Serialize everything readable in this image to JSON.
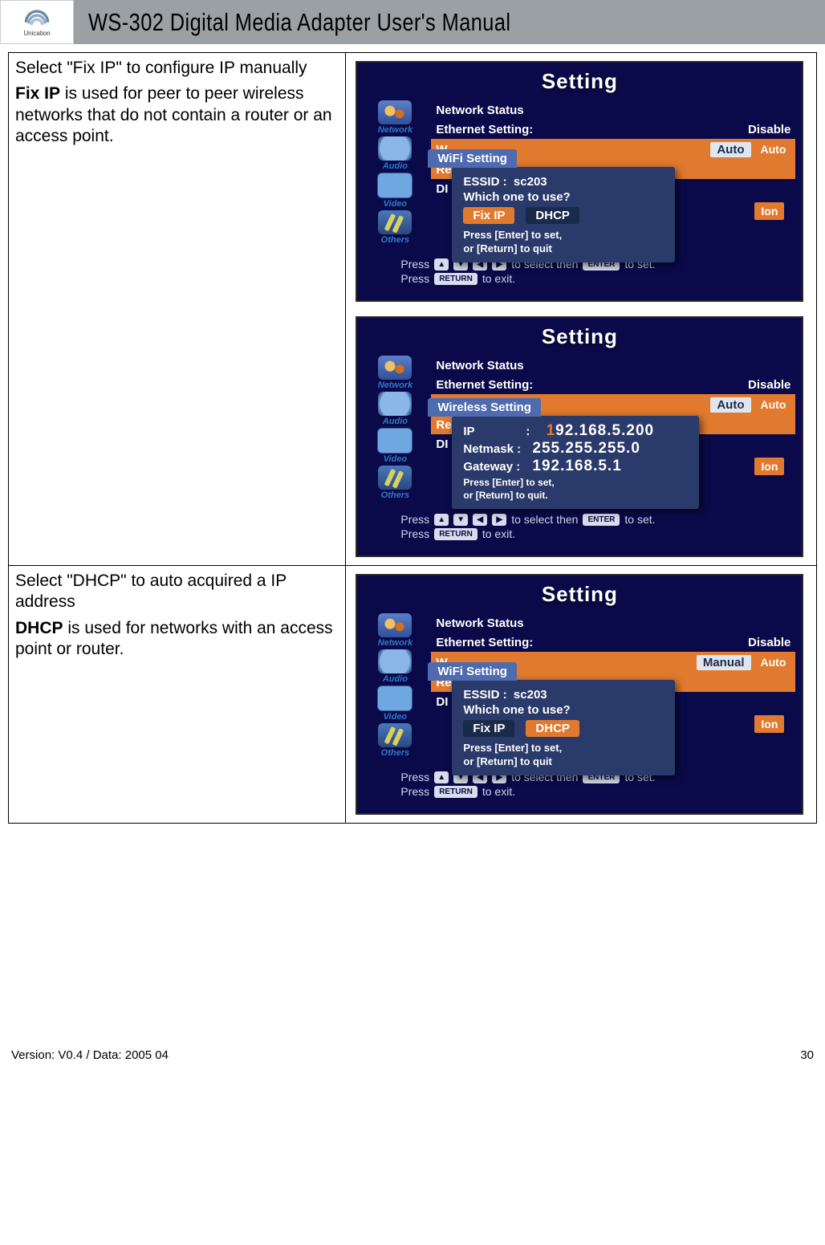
{
  "header": {
    "logo_brand": "Unication",
    "title": "WS-302 Digital Media Adapter User's Manual"
  },
  "steps": [
    {
      "intro": "Select \"Fix IP\" to configure IP manually",
      "bold": "Fix IP",
      "body_after_bold": " is used for peer to peer wireless networks that do not contain a router or an access point."
    },
    {
      "intro": "Select \"DHCP\" to auto acquired a IP address",
      "bold": "DHCP",
      "body_after_bold": " is used for networks with an access point or router."
    }
  ],
  "ui": {
    "window_title": "Setting",
    "side": [
      {
        "label": "Network",
        "icon": "network"
      },
      {
        "label": "Audio",
        "icon": "audio"
      },
      {
        "label": "Video",
        "icon": "video"
      },
      {
        "label": "Others",
        "icon": "others"
      }
    ],
    "rows": {
      "network_status": "Network Status",
      "ethernet_setting": "Ethernet Setting:",
      "ethernet_value": "Disable",
      "wifi_setting_short": "W",
      "wifi_row_auto": "Auto",
      "wifi_row_manual": "Manual",
      "wifi_row_auto2": "Auto",
      "re": "Re",
      "di": "DI",
      "ion": "Ion"
    },
    "popup_wifi": {
      "tab": "WiFi Setting",
      "essid_label": "ESSID :",
      "essid_value": "sc203",
      "question": "Which one to use?",
      "btn_fixip": "Fix IP",
      "btn_dhcp": "DHCP",
      "hint1": "Press [Enter] to set,",
      "hint2": "or [Return] to quit"
    },
    "popup_wireless": {
      "tab": "Wireless Setting",
      "ip_label": "IP",
      "ip_value": "192.168.5.200",
      "ip_cursor": "1",
      "netmask_label": "Netmask :",
      "netmask_value": "255.255.255.0",
      "gateway_label": "Gateway :",
      "gateway_value": "192.168.5.1",
      "hint1": "Press [Enter] to set,",
      "hint2": "or [Return] to quit."
    },
    "footer": {
      "line1_a": "Press",
      "line1_b": "to select then",
      "line1_c": "to set.",
      "enter": "ENTER",
      "line2_a": "Press",
      "line2_b": "to exit.",
      "return": "RETURN",
      "arrows": [
        "▲",
        "▼",
        "◀",
        "▶"
      ]
    }
  },
  "footer": {
    "version": "Version: V0.4 / Data: 2005 04",
    "page": "30"
  }
}
